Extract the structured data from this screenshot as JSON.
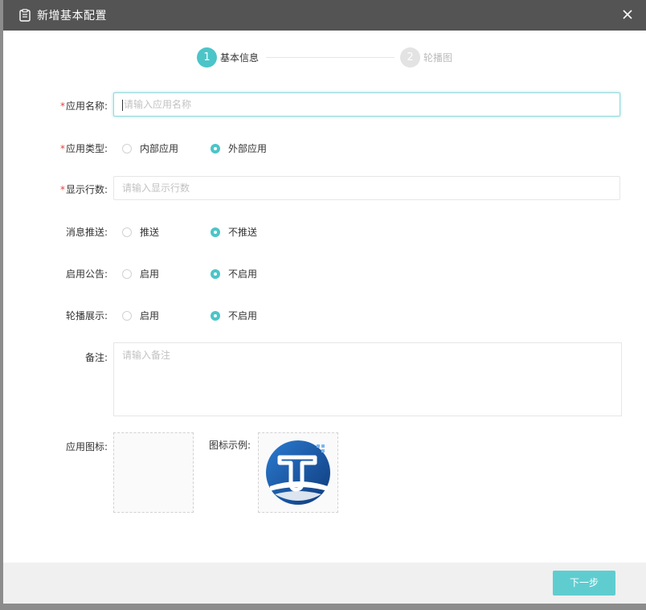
{
  "dialog": {
    "title": "新增基本配置",
    "close_icon": "close-icon",
    "title_icon": "clipboard-icon"
  },
  "steps": [
    {
      "number": "1",
      "label": "基本信息",
      "active": true
    },
    {
      "number": "2",
      "label": "轮播图",
      "active": false
    }
  ],
  "form": {
    "app_name": {
      "label": "应用名称:",
      "required": true,
      "placeholder": "请输入应用名称",
      "value": ""
    },
    "app_type": {
      "label": "应用类型:",
      "required": true,
      "options": [
        "内部应用",
        "外部应用"
      ],
      "selected": "外部应用"
    },
    "display_rows": {
      "label": "显示行数:",
      "required": true,
      "placeholder": "请输入显示行数",
      "value": ""
    },
    "push": {
      "label": "消息推送:",
      "required": false,
      "options": [
        "推送",
        "不推送"
      ],
      "selected": "不推送"
    },
    "announcement": {
      "label": "启用公告:",
      "required": false,
      "options": [
        "启用",
        "不启用"
      ],
      "selected": "不启用"
    },
    "carousel": {
      "label": "轮播展示:",
      "required": false,
      "options": [
        "启用",
        "不启用"
      ],
      "selected": "不启用"
    },
    "remark": {
      "label": "备注:",
      "required": false,
      "placeholder": "请输入备注",
      "value": ""
    },
    "app_icon": {
      "label": "应用图标:"
    },
    "icon_example": {
      "label": "图标示例:",
      "logo_letter": "T"
    }
  },
  "footer": {
    "next_label": "下一步"
  },
  "colors": {
    "accent": "#4cc5c8",
    "button": "#5fcdd0",
    "titlebar": "#545454",
    "required": "#e64242"
  }
}
